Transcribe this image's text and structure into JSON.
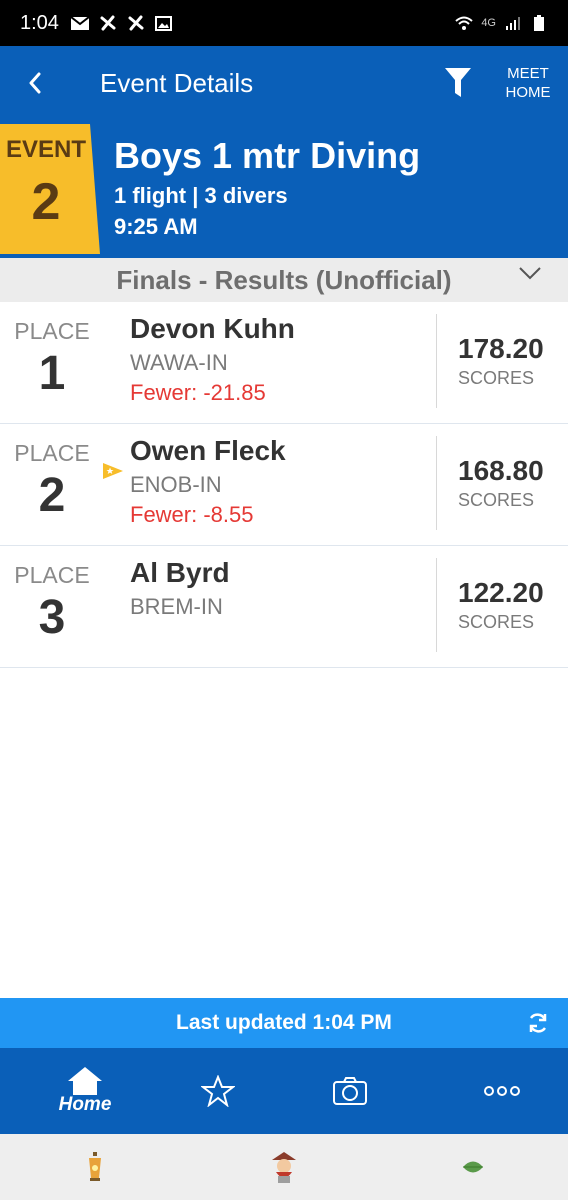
{
  "status_bar": {
    "time": "1:04",
    "network": "4G"
  },
  "header": {
    "title": "Event Details",
    "back_icon": "chevron-left-icon",
    "filter_icon": "filter-icon",
    "meet_home_label": "MEET\nHOME"
  },
  "event": {
    "badge_label": "EVENT",
    "number": "2",
    "title": "Boys 1 mtr Diving",
    "meta": "1 flight | 3 divers",
    "time": "9:25 AM"
  },
  "section": {
    "title": "Finals - Results (Unofficial)"
  },
  "results": [
    {
      "place_label": "PLACE",
      "place": "1",
      "name": "Devon Kuhn",
      "team": "WAWA-IN",
      "diff": "Fewer: -21.85",
      "score": "178.20",
      "score_label": "SCORES",
      "starred": false
    },
    {
      "place_label": "PLACE",
      "place": "2",
      "name": "Owen Fleck",
      "team": "ENOB-IN",
      "diff": "Fewer: -8.55",
      "score": "168.80",
      "score_label": "SCORES",
      "starred": true
    },
    {
      "place_label": "PLACE",
      "place": "3",
      "name": "Al Byrd",
      "team": "BREM-IN",
      "diff": "",
      "score": "122.20",
      "score_label": "SCORES",
      "starred": false
    }
  ],
  "updated": {
    "text": "Last updated 1:04 PM"
  },
  "bottom_nav": {
    "home_label": "Home",
    "items": [
      "home-icon",
      "star-icon",
      "camera-icon",
      "more-icon"
    ]
  },
  "colors": {
    "primary": "#0a5fb8",
    "accent": "#f7bd2a",
    "updated_bar": "#2196f3",
    "negative": "#e53935"
  }
}
